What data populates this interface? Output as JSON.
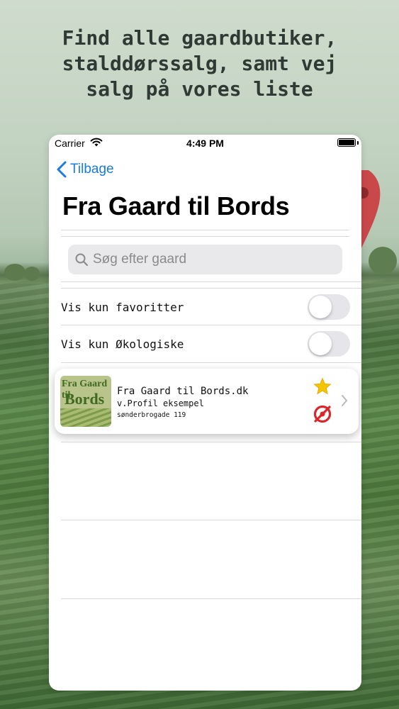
{
  "promo": {
    "headline_line1": "Find alle gaardbutiker,",
    "headline_line2": "stalddørssalg, samt vej",
    "headline_line3": "salg på vores liste"
  },
  "status_bar": {
    "carrier": "Carrier",
    "time": "4:49 PM"
  },
  "nav": {
    "back_label": "Tilbage",
    "title": "Fra Gaard til Bords"
  },
  "search": {
    "placeholder": "Søg efter gaard"
  },
  "filters": [
    {
      "label": "Vis kun favoritter",
      "on": false
    },
    {
      "label": "Vis kun Økologiske",
      "on": false
    }
  ],
  "list": [
    {
      "name": "Fra Gaard til Bords.dk",
      "subtitle": "v.Profil eksempel",
      "address": "sønderbrogade 119",
      "logo_line1": "Fra Gaard til",
      "logo_line2": "Bords",
      "favorite": true,
      "organic": true
    }
  ],
  "colors": {
    "accent": "#1a7ae0",
    "star": "#f5c400",
    "organic_red": "#d9262b"
  },
  "icons": [
    "wifi-icon",
    "battery-icon",
    "back-chevron-icon",
    "search-icon",
    "star-icon",
    "organic-label-icon",
    "chevron-right-icon",
    "map-pin-icon"
  ]
}
